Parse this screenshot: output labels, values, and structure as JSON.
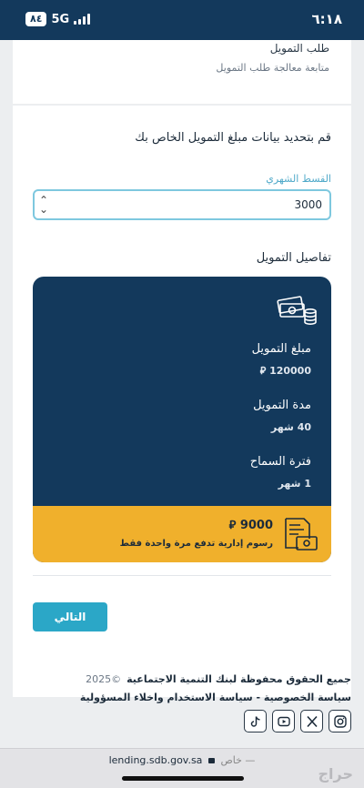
{
  "status_bar": {
    "time": "٦:١٨",
    "battery": "٨٤",
    "network": "5G"
  },
  "top_section": {
    "title": "طلب التمويل",
    "subtitle": "متابعة معالجة طلب التمويل"
  },
  "form": {
    "heading": "قم بتحديد بيانات مبلغ التمويل الخاص بك",
    "installment_label": "القسط الشهري",
    "installment_value": "3000"
  },
  "details": {
    "title": "تفاصيل التمويل",
    "items": [
      {
        "label": "مبلغ التمويل",
        "value": "120000 ⃁"
      },
      {
        "label": "مدة التمويل",
        "value": "40 شهر"
      },
      {
        "label": "فترة السماح",
        "value": "1 شهر"
      }
    ],
    "fee_amount": "9000 ⃁",
    "fee_note": "رسوم إدارية تدفع مرة واحدة فقط"
  },
  "actions": {
    "next_label": "التالي"
  },
  "footer": {
    "copyright": "جميع الحقوق محفوظة لبنك التنمية الاجتماعية",
    "year": "©2025",
    "links": "سياسة الخصوصية - سياسة الاستخدام واخلاء المسؤولية",
    "social": [
      "instagram-icon",
      "x-icon",
      "youtube-icon",
      "tiktok-icon"
    ]
  },
  "browser": {
    "url": "lending.sdb.gov.sa",
    "private_label": "خاص —",
    "watermark": "حراج"
  },
  "colors": {
    "primary": "#13395c",
    "accent": "#f0b02c",
    "button": "#2ba7c7"
  }
}
